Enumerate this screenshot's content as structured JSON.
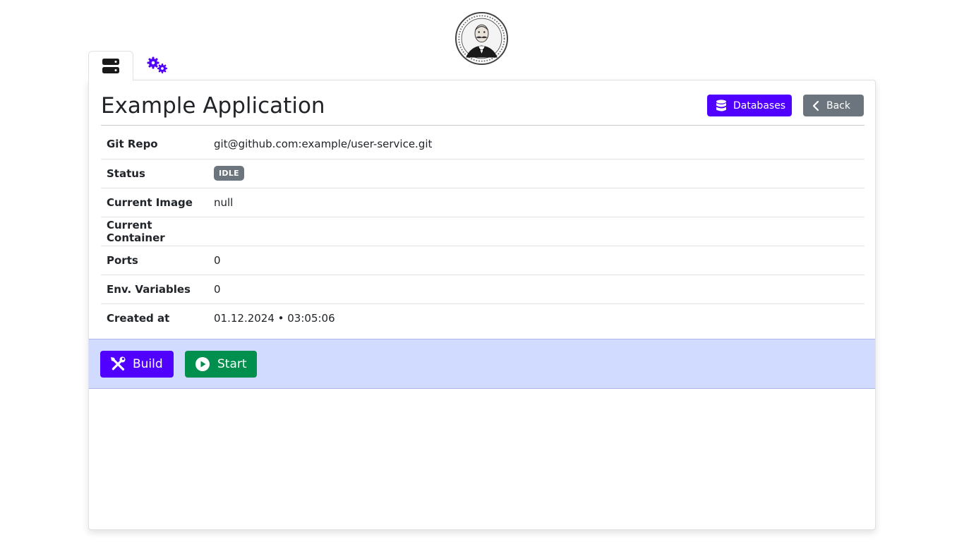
{
  "header": {
    "logo_icon": "gentleman-portrait-logo"
  },
  "tabs": [
    {
      "icon": "server-icon",
      "active": true
    },
    {
      "icon": "gears-icon",
      "active": false
    }
  ],
  "page": {
    "title": "Example Application",
    "databases_label": "Databases",
    "back_label": "Back"
  },
  "info": {
    "git_repo_label": "Git Repo",
    "git_repo_value": "git@github.com:example/user-service.git",
    "status_label": "Status",
    "status_value": "IDLE",
    "image_label": "Current Image",
    "image_value": "null",
    "container_label": "Current Container",
    "container_value": "",
    "ports_label": "Ports",
    "ports_value": "0",
    "env_label": "Env. Variables",
    "env_value": "0",
    "created_label": "Created at",
    "created_value": "01.12.2024 • 03:05:06"
  },
  "actions": {
    "build_label": "Build",
    "start_label": "Start"
  },
  "colors": {
    "primary": "#5000ff",
    "secondary": "#6c757d",
    "success": "#008f4c",
    "action_bar": "#d0dbff"
  }
}
